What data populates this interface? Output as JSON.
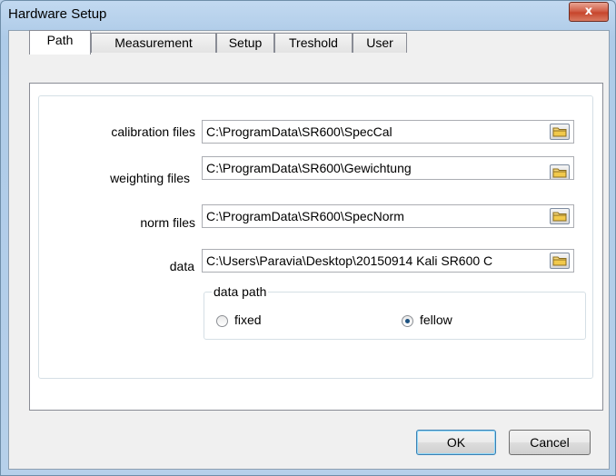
{
  "window": {
    "title": "Hardware Setup",
    "close_label": "x"
  },
  "tabs": [
    {
      "label": "Path",
      "active": true
    },
    {
      "label": "Measurement",
      "active": false
    },
    {
      "label": "Setup",
      "active": false
    },
    {
      "label": "Treshold",
      "active": false
    },
    {
      "label": "User",
      "active": false
    }
  ],
  "paths": {
    "calibration": {
      "label": "calibration files",
      "value": "C:\\ProgramData\\SR600\\SpecCal"
    },
    "weighting": {
      "label": "weighting files",
      "value": "C:\\ProgramData\\SR600\\Gewichtung"
    },
    "norm": {
      "label": "norm files",
      "value": "C:\\ProgramData\\SR600\\SpecNorm"
    },
    "data": {
      "label": "data",
      "value": "C:\\Users\\Paravia\\Desktop\\20150914 Kali SR600 C"
    }
  },
  "data_path": {
    "legend": "data path",
    "options": [
      {
        "label": "fixed",
        "checked": false
      },
      {
        "label": "fellow",
        "checked": true
      }
    ]
  },
  "buttons": {
    "ok": "OK",
    "cancel": "Cancel"
  },
  "icons": {
    "browse": "folder-icon",
    "close": "close-icon"
  }
}
